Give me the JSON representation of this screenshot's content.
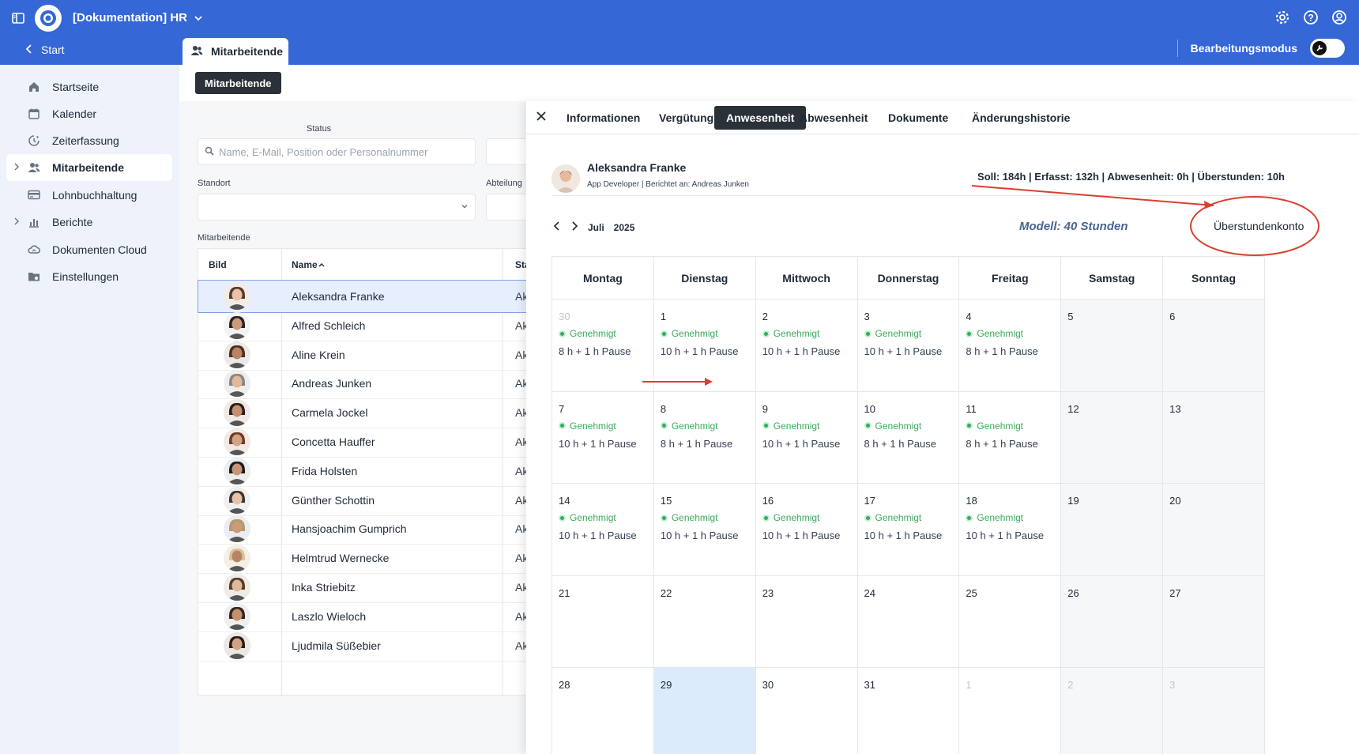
{
  "header": {
    "app_title": "[Dokumentation] HR",
    "start_label": "Start",
    "tab_label": "Mitarbeitende",
    "edit_mode_label": "Bearbeitungsmodus",
    "accent_color": "#3567d6"
  },
  "sidebar": {
    "items": [
      {
        "label": "Startseite",
        "icon": "home-icon"
      },
      {
        "label": "Kalender",
        "icon": "calendar-icon"
      },
      {
        "label": "Zeiterfassung",
        "icon": "clock-icon"
      },
      {
        "label": "Mitarbeitende",
        "icon": "users-icon"
      },
      {
        "label": "Lohnbuchhaltung",
        "icon": "payroll-icon"
      },
      {
        "label": "Berichte",
        "icon": "chart-icon"
      },
      {
        "label": "Dokumenten Cloud",
        "icon": "cloud-icon"
      },
      {
        "label": "Einstellungen",
        "icon": "folder-gear-icon"
      }
    ],
    "active": "Mitarbeitende"
  },
  "list": {
    "chip": "Mitarbeitende",
    "status_label": "Status",
    "search_placeholder": "Name, E-Mail, Position oder Personalnummer",
    "standort_label": "Standort",
    "abteilung_label": "Abteilung",
    "table_label": "Mitarbeitende",
    "columns": [
      "Bild",
      "Name",
      "Sta"
    ],
    "rows": [
      {
        "name": "Aleksandra Franke",
        "status": "Ak"
      },
      {
        "name": "Alfred Schleich",
        "status": "Ak"
      },
      {
        "name": "Aline Krein",
        "status": "Ak"
      },
      {
        "name": "Andreas Junken",
        "status": "Ak"
      },
      {
        "name": "Carmela Jockel",
        "status": "Ak"
      },
      {
        "name": "Concetta Hauffer",
        "status": "Ak"
      },
      {
        "name": "Frida Holsten",
        "status": "Ak"
      },
      {
        "name": "Günther Schottin",
        "status": "Ak"
      },
      {
        "name": "Hansjoachim Gumprich",
        "status": "Ak"
      },
      {
        "name": "Helmtrud Wernecke",
        "status": "Ak"
      },
      {
        "name": "Inka Striebitz",
        "status": "Ak"
      },
      {
        "name": "Laszlo Wieloch",
        "status": "Ak"
      },
      {
        "name": "Ljudmila Süßebier",
        "status": "Ak"
      }
    ]
  },
  "panel": {
    "tabs": [
      "Informationen",
      "Vergütung",
      "Anwesenheit",
      "Abwesenheit",
      "Dokumente",
      "Änderungshistorie"
    ],
    "active_tab": "Anwesenheit",
    "employee": {
      "name": "Aleksandra Franke",
      "subtitle": "App Developer | Berichtet an: Andreas Junken",
      "stats": "Soll: 184h | Erfasst: 132h | Abwesenheit: 0h | Überstunden: 10h"
    },
    "month": "Juli",
    "year": "2025",
    "annotation_model": "Modell: 40 Stunden",
    "annotation_account": "Überstundenkonto",
    "weekdays": [
      "Montag",
      "Dienstag",
      "Mittwoch",
      "Donnerstag",
      "Freitag",
      "Samstag",
      "Sonntag"
    ],
    "status_text": "Genehmigt",
    "weeks": [
      [
        {
          "day": "30",
          "muted": true,
          "hours": "8 h + 1 h Pause"
        },
        {
          "day": "1",
          "hours": "10 h + 1 h Pause"
        },
        {
          "day": "2",
          "hours": "10 h + 1 h Pause"
        },
        {
          "day": "3",
          "hours": "10 h + 1 h Pause"
        },
        {
          "day": "4",
          "hours": "8 h + 1 h Pause"
        },
        {
          "day": "5",
          "weekend": true
        },
        {
          "day": "6",
          "weekend": true
        }
      ],
      [
        {
          "day": "7",
          "hours": "10 h + 1 h Pause"
        },
        {
          "day": "8",
          "hours": "8 h + 1 h Pause"
        },
        {
          "day": "9",
          "hours": "10 h + 1 h Pause"
        },
        {
          "day": "10",
          "hours": "8 h + 1 h Pause"
        },
        {
          "day": "11",
          "hours": "8 h + 1 h Pause"
        },
        {
          "day": "12",
          "weekend": true
        },
        {
          "day": "13",
          "weekend": true
        }
      ],
      [
        {
          "day": "14",
          "hours": "10 h + 1 h Pause"
        },
        {
          "day": "15",
          "hours": "10 h + 1 h Pause"
        },
        {
          "day": "16",
          "hours": "10 h + 1 h Pause"
        },
        {
          "day": "17",
          "hours": "10 h + 1 h Pause"
        },
        {
          "day": "18",
          "hours": "10 h + 1 h Pause"
        },
        {
          "day": "19",
          "weekend": true
        },
        {
          "day": "20",
          "weekend": true
        }
      ],
      [
        {
          "day": "21"
        },
        {
          "day": "22"
        },
        {
          "day": "23"
        },
        {
          "day": "24"
        },
        {
          "day": "25"
        },
        {
          "day": "26",
          "weekend": true
        },
        {
          "day": "27",
          "weekend": true
        }
      ],
      [
        {
          "day": "28"
        },
        {
          "day": "29",
          "today": true
        },
        {
          "day": "30"
        },
        {
          "day": "31"
        },
        {
          "day": "1",
          "muted": true
        },
        {
          "day": "2",
          "muted": true,
          "weekend": true
        },
        {
          "day": "3",
          "muted": true,
          "weekend": true
        }
      ]
    ],
    "status_color": "#3daa5c",
    "annotation_color": "#d8412f"
  }
}
